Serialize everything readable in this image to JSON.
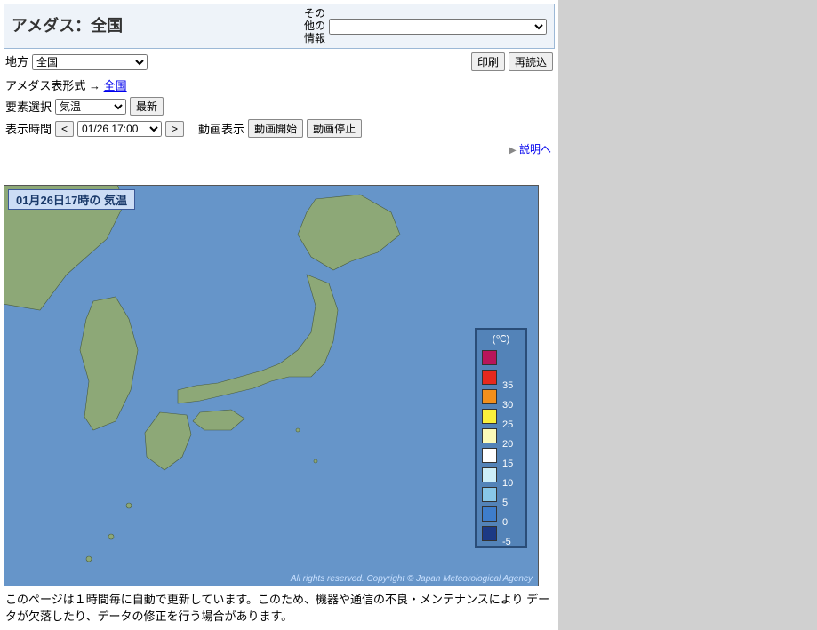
{
  "title": "アメダス：全国",
  "other_info": {
    "label_line1": "その",
    "label_line2": "他の",
    "label_line3": "情報"
  },
  "region": {
    "label": "地方",
    "selected": "全国"
  },
  "print_btn": "印刷",
  "reload_btn": "再読込",
  "table_format": {
    "prefix": "アメダス表形式 → ",
    "link": "全国"
  },
  "element": {
    "label": "要素選択",
    "selected": "気温",
    "latest_btn": "最新"
  },
  "time": {
    "label": "表示時間",
    "prev_btn": "<",
    "selected": "01/26 17:00",
    "next_btn": ">"
  },
  "animation": {
    "label": "動画表示",
    "start_btn": "動画開始",
    "stop_btn": "動画停止"
  },
  "explain_link": "説明へ",
  "map": {
    "title": "01月26日17時の 気温",
    "copyright": "All rights reserved. Copyright © Japan Meteorological Agency"
  },
  "legend": {
    "unit": "(℃)",
    "items": [
      {
        "color": "#b8155a",
        "value": ""
      },
      {
        "color": "#e6281e",
        "value": "35"
      },
      {
        "color": "#f28f1c",
        "value": "30"
      },
      {
        "color": "#faf03c",
        "value": "25"
      },
      {
        "color": "#fbfab9",
        "value": "20"
      },
      {
        "color": "#ffffff",
        "value": "15"
      },
      {
        "color": "#cdeef8",
        "value": "10"
      },
      {
        "color": "#88c7e8",
        "value": "5"
      },
      {
        "color": "#3e7dcb",
        "value": "0"
      },
      {
        "color": "#1c3a85",
        "value": "-5"
      }
    ]
  },
  "footnote": "このページは１時間毎に自動で更新しています。このため、機器や通信の不良・メンテナンスにより データが欠落したり、データの修正を行う場合があります。"
}
